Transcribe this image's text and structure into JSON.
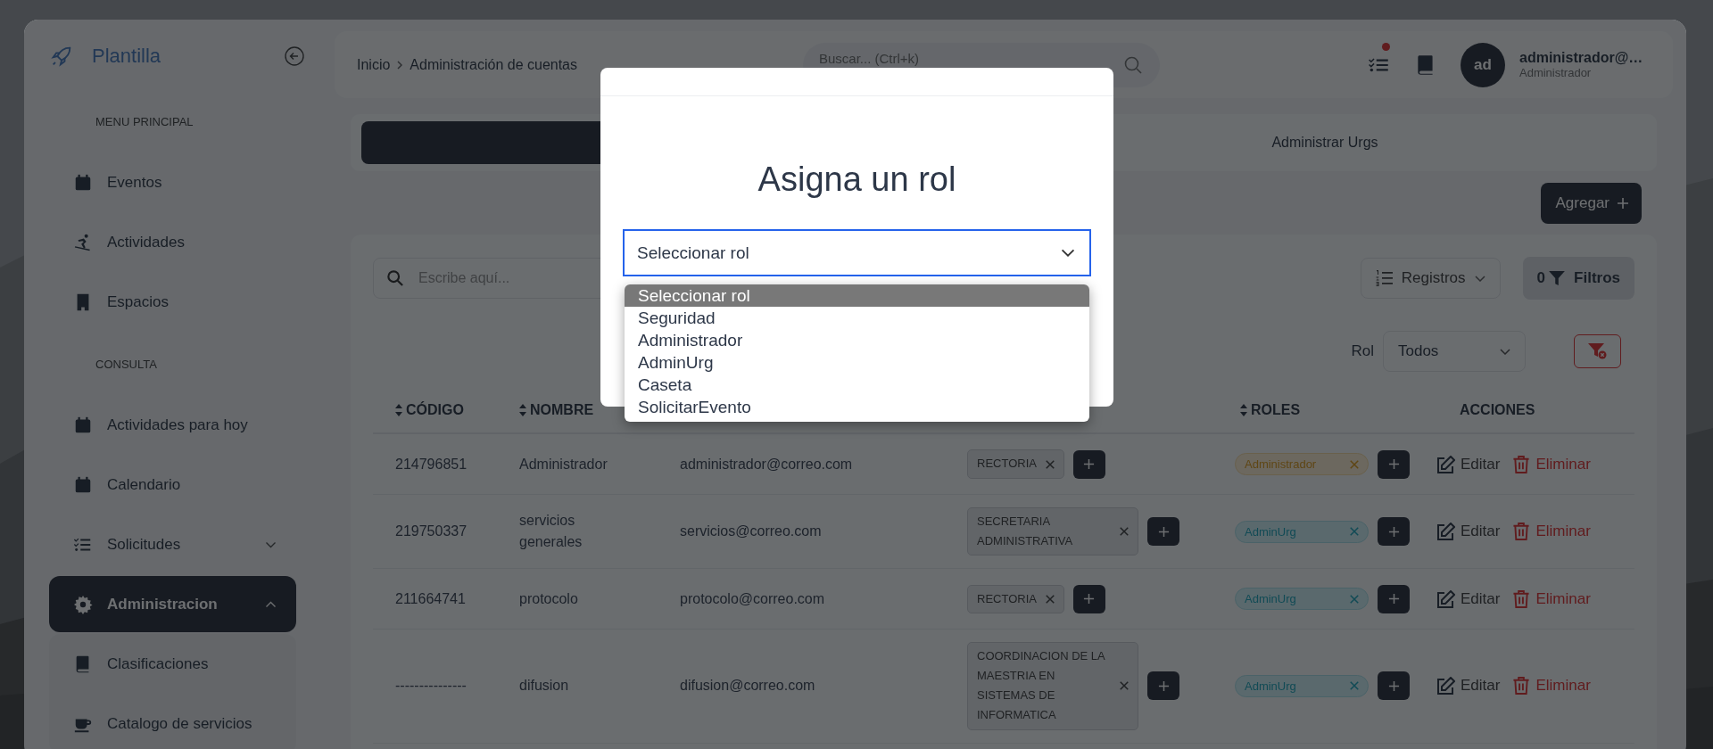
{
  "sidebar": {
    "brand": "Plantilla",
    "sections": [
      {
        "heading": "MENU PRINCIPAL",
        "items": [
          {
            "label": "Eventos",
            "kind": "link",
            "selected": false
          },
          {
            "label": "Actividades",
            "kind": "link",
            "selected": false
          },
          {
            "label": "Espacios",
            "kind": "link",
            "selected": false
          }
        ]
      },
      {
        "heading": "CONSULTA",
        "items": [
          {
            "label": "Actividades para hoy",
            "kind": "link",
            "selected": false
          },
          {
            "label": "Calendario",
            "kind": "link",
            "selected": false
          },
          {
            "label": "Solicitudes",
            "kind": "group",
            "expanded": false,
            "selected": false
          },
          {
            "label": "Administracion",
            "kind": "group",
            "expanded": true,
            "selected": true,
            "children": [
              {
                "label": "Clasificaciones"
              },
              {
                "label": "Catalogo de servicios"
              }
            ]
          }
        ]
      }
    ]
  },
  "header": {
    "breadcrumb": [
      "Inicio",
      "Administración de cuentas"
    ],
    "search": {
      "placeholder": "Buscar... (Ctrl+k)"
    },
    "notification": true,
    "user": {
      "initials": "ad",
      "name": "administrador@…",
      "role": "Administrador"
    }
  },
  "tabs": [
    {
      "selected": true
    },
    {
      "label": "Administrar Urgs",
      "selected": false
    }
  ],
  "add_button": "Agregar",
  "toolbar": {
    "search": {
      "placeholder": "Escribe aquí..."
    },
    "records": "Registros",
    "filters": {
      "count": "0",
      "label": "Filtros"
    },
    "role_filter": {
      "label": "Rol",
      "value": "Todos"
    }
  },
  "table": {
    "columns": [
      {
        "label": "CÓDIGO",
        "sortable": true
      },
      {
        "label": "NOMBRE",
        "sortable": true
      },
      {},
      {},
      {
        "label": "ROLES",
        "sortable": true
      },
      {
        "label": "ACCIONES",
        "sortable": false
      }
    ],
    "rows": [
      {
        "code": "214796851",
        "name": "Administrador",
        "email": "administrador@correo.com",
        "urgs": [
          {
            "label": "RECTORIA"
          }
        ],
        "roles": [
          {
            "label": "Administrador",
            "kind": "warning"
          }
        ],
        "actions": [
          {
            "label": "Editar",
            "kind": "edit"
          },
          {
            "label": "Eliminar",
            "kind": "delete"
          }
        ]
      },
      {
        "code": "219750337",
        "name": "servicios generales",
        "email": "servicios@correo.com",
        "urgs": [
          {
            "label": "SECRETARIA ADMINISTRATIVA"
          }
        ],
        "roles": [
          {
            "label": "AdminUrg",
            "kind": "info"
          }
        ],
        "actions": [
          {
            "label": "Editar",
            "kind": "edit"
          },
          {
            "label": "Eliminar",
            "kind": "delete"
          }
        ]
      },
      {
        "code": "211664741",
        "name": "protocolo",
        "email": "protocolo@correo.com",
        "urgs": [
          {
            "label": "RECTORIA"
          }
        ],
        "roles": [
          {
            "label": "AdminUrg",
            "kind": "info"
          }
        ],
        "actions": [
          {
            "label": "Editar",
            "kind": "edit"
          },
          {
            "label": "Eliminar",
            "kind": "delete"
          }
        ]
      },
      {
        "code": "---------------",
        "name": "difusion",
        "email": "difusion@correo.com",
        "urgs": [
          {
            "label": "COORDINACION DE LA MAESTRIA EN SISTEMAS DE INFORMATICA"
          }
        ],
        "roles": [
          {
            "label": "AdminUrg",
            "kind": "info"
          }
        ],
        "actions": [
          {
            "label": "Editar",
            "kind": "edit"
          },
          {
            "label": "Eliminar",
            "kind": "delete"
          }
        ]
      }
    ]
  },
  "modal": {
    "title": "Asigna un rol",
    "select": {
      "value": "Seleccionar rol",
      "expanded": true,
      "options": [
        {
          "label": "Seleccionar rol",
          "selected": true
        },
        {
          "label": "Seguridad",
          "selected": false
        },
        {
          "label": "Administrador",
          "selected": false
        },
        {
          "label": "AdminUrg",
          "selected": false
        },
        {
          "label": "Caseta",
          "selected": false
        },
        {
          "label": "SolicitarEvento",
          "selected": false
        }
      ]
    }
  }
}
